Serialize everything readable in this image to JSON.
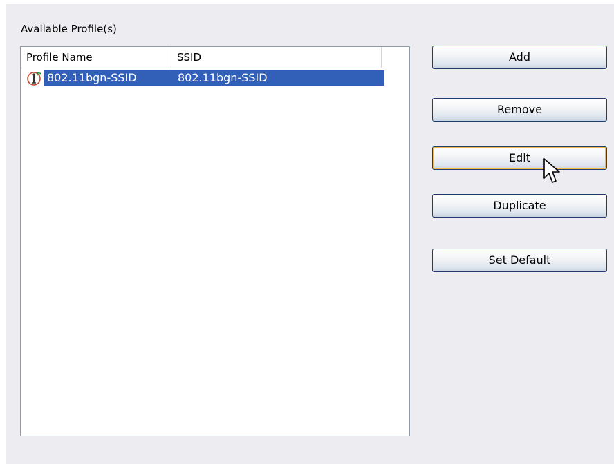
{
  "group": {
    "label": "Available Profile(s)"
  },
  "profile_list": {
    "columns": [
      "Profile Name",
      "SSID"
    ],
    "rows": [
      {
        "profile_name": "802.11bgn-SSID",
        "ssid": "802.11bgn-SSID",
        "selected": true,
        "icon": "wireless-profile-icon"
      }
    ]
  },
  "buttons": {
    "add": "Add",
    "remove": "Remove",
    "edit": "Edit",
    "duplicate": "Duplicate",
    "set_default": "Set Default"
  },
  "colors": {
    "panel_bg": "#edecf1",
    "selection": "#3260b8",
    "button_border": "#1f3e6e",
    "focus_ring": "#f2b649"
  }
}
